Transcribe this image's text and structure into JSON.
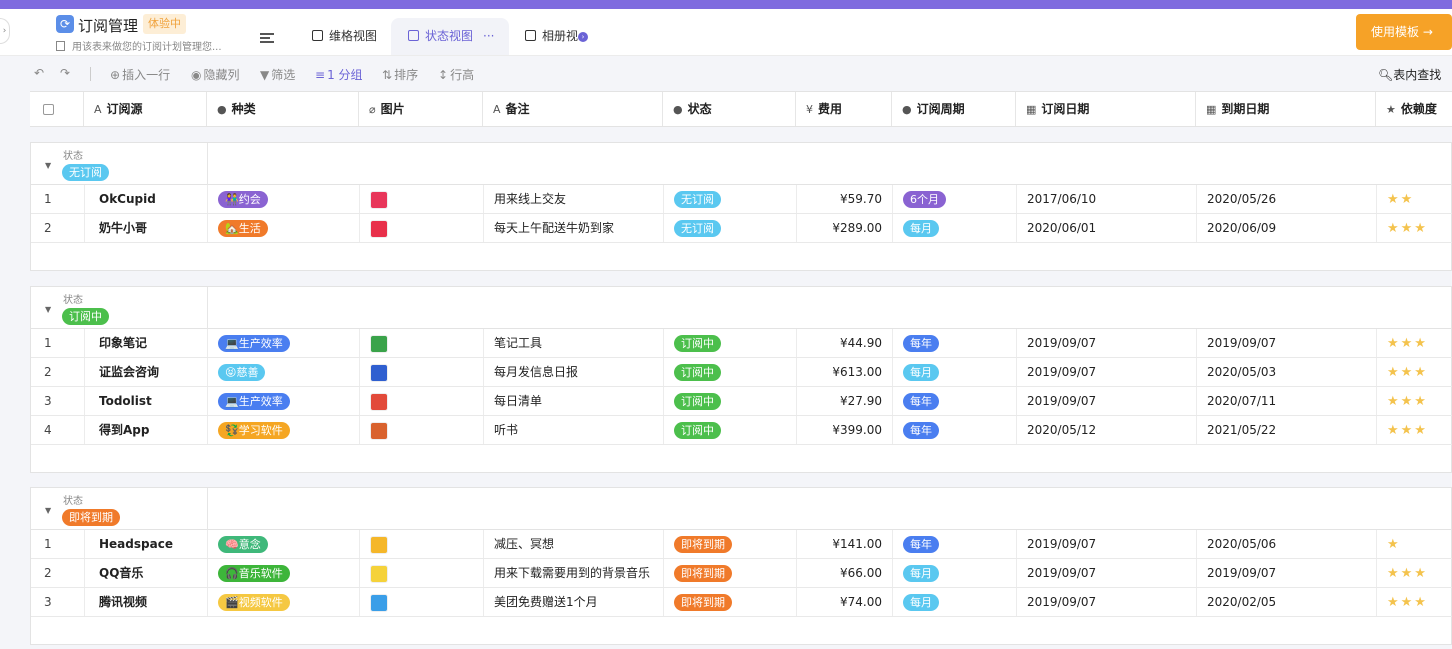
{
  "app": {
    "title": "订阅管理",
    "trial_badge": "体验中",
    "description": "用该表来做您的订阅计划管理您...",
    "use_template": "使用模板 →"
  },
  "tabs": [
    {
      "label": "维格视图"
    },
    {
      "label": "状态视图",
      "active": true,
      "dots": "···"
    },
    {
      "label": "相册视"
    }
  ],
  "toolbar": {
    "undo": "↶",
    "redo": "↷",
    "insert_row": "插入一行",
    "hide_cols": "隐藏列",
    "filter": "筛选",
    "group": "1 分组",
    "sort": "排序",
    "row_height": "行高",
    "search": "表内查找"
  },
  "columns": [
    {
      "label": "订阅源",
      "icon": "A"
    },
    {
      "label": "种类",
      "icon": "●"
    },
    {
      "label": "图片",
      "icon": "⌀"
    },
    {
      "label": "备注",
      "icon": "A"
    },
    {
      "label": "状态",
      "icon": "●"
    },
    {
      "label": "费用",
      "icon": "¥"
    },
    {
      "label": "订阅周期",
      "icon": "●"
    },
    {
      "label": "订阅日期",
      "icon": "▦"
    },
    {
      "label": "到期日期",
      "icon": "▦"
    },
    {
      "label": "依赖度",
      "icon": "★"
    }
  ],
  "group_field_label": "状态",
  "groups": [
    {
      "name": "无订阅",
      "color": "#5ac8f0",
      "rows": [
        {
          "idx": "1",
          "name": "OkCupid",
          "category": "👫约会",
          "cat_color": "#8a63d2",
          "img_color": "#e8365a",
          "note": "用来线上交友",
          "status": "无订阅",
          "status_color": "#5ac8f0",
          "fee": "¥59.70",
          "cycle": "6个月",
          "cycle_color": "#8a63d2",
          "start": "2017/06/10",
          "end": "2020/05/26",
          "stars": "★★"
        },
        {
          "idx": "2",
          "name": "奶牛小哥",
          "category": "🏡生活",
          "cat_color": "#f07a2a",
          "img_color": "#e8304a",
          "note": "每天上午配送牛奶到家",
          "status": "无订阅",
          "status_color": "#5ac8f0",
          "fee": "¥289.00",
          "cycle": "每月",
          "cycle_color": "#5ac8f0",
          "start": "2020/06/01",
          "end": "2020/06/09",
          "stars": "★★★"
        }
      ]
    },
    {
      "name": "订阅中",
      "color": "#4cbf4c",
      "rows": [
        {
          "idx": "1",
          "name": "印象笔记",
          "category": "💻生产效率",
          "cat_color": "#4a7ef0",
          "img_color": "#3aa34a",
          "note": "笔记工具",
          "status": "订阅中",
          "status_color": "#4cbf4c",
          "fee": "¥44.90",
          "cycle": "每年",
          "cycle_color": "#4a7ef0",
          "start": "2019/09/07",
          "end": "2019/09/07",
          "stars": "★★★"
        },
        {
          "idx": "2",
          "name": "证监会咨询",
          "category": "😝慈善",
          "cat_color": "#5ac8f0",
          "img_color": "#2f5fd0",
          "note": "每月发信息日报",
          "status": "订阅中",
          "status_color": "#4cbf4c",
          "fee": "¥613.00",
          "cycle": "每月",
          "cycle_color": "#5ac8f0",
          "start": "2019/09/07",
          "end": "2020/05/03",
          "stars": "★★★"
        },
        {
          "idx": "3",
          "name": "Todolist",
          "category": "💻生产效率",
          "cat_color": "#4a7ef0",
          "img_color": "#e24a3a",
          "note": "每日清单",
          "status": "订阅中",
          "status_color": "#4cbf4c",
          "fee": "¥27.90",
          "cycle": "每年",
          "cycle_color": "#4a7ef0",
          "start": "2019/09/07",
          "end": "2020/07/11",
          "stars": "★★★"
        },
        {
          "idx": "4",
          "name": "得到App",
          "category": "💱学习软件",
          "cat_color": "#f5a623",
          "img_color": "#d9622e",
          "note": "听书",
          "status": "订阅中",
          "status_color": "#4cbf4c",
          "fee": "¥399.00",
          "cycle": "每年",
          "cycle_color": "#4a7ef0",
          "start": "2020/05/12",
          "end": "2021/05/22",
          "stars": "★★★"
        }
      ]
    },
    {
      "name": "即将到期",
      "color": "#f07a2a",
      "rows": [
        {
          "idx": "1",
          "name": "Headspace",
          "category": "🧠意念",
          "cat_color": "#3fb87a",
          "img_color": "#f5b72a",
          "note": "减压、冥想",
          "status": "即将到期",
          "status_color": "#f07a2a",
          "fee": "¥141.00",
          "cycle": "每年",
          "cycle_color": "#4a7ef0",
          "start": "2019/09/07",
          "end": "2020/05/06",
          "stars": "★"
        },
        {
          "idx": "2",
          "name": "QQ音乐",
          "category": "🎧音乐软件",
          "cat_color": "#3db53a",
          "img_color": "#f5d23a",
          "note": "用来下载需要用到的背景音乐",
          "status": "即将到期",
          "status_color": "#f07a2a",
          "fee": "¥66.00",
          "cycle": "每月",
          "cycle_color": "#5ac8f0",
          "start": "2019/09/07",
          "end": "2019/09/07",
          "stars": "★★★"
        },
        {
          "idx": "3",
          "name": "腾讯视频",
          "category": "🎬视频软件",
          "cat_color": "#f5c842",
          "img_color": "#3a9ee8",
          "note": "美团免费赠送1个月",
          "status": "即将到期",
          "status_color": "#f07a2a",
          "fee": "¥74.00",
          "cycle": "每月",
          "cycle_color": "#5ac8f0",
          "start": "2019/09/07",
          "end": "2020/02/05",
          "stars": "★★★"
        }
      ]
    }
  ]
}
